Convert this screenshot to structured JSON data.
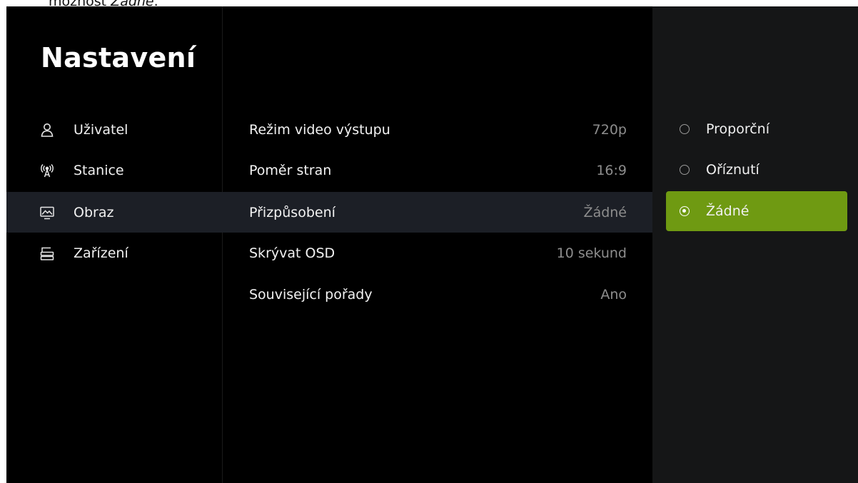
{
  "doc_note": {
    "prefix": "možnost ",
    "emphasis": "Žádné",
    "suffix": "."
  },
  "header": {
    "title": "Nastavení"
  },
  "nav": {
    "items": [
      {
        "label": "Uživatel",
        "icon": "user-icon"
      },
      {
        "label": "Stanice",
        "icon": "antenna-icon"
      },
      {
        "label": "Obraz",
        "icon": "picture-icon",
        "active": true
      },
      {
        "label": "Zařízení",
        "icon": "set-top-box-icon"
      }
    ]
  },
  "settings": {
    "rows": [
      {
        "name": "Režim video výstupu",
        "value": "720p"
      },
      {
        "name": "Poměr stran",
        "value": "16:9"
      },
      {
        "name": "Přizpůsobení",
        "value": "Žádné",
        "active": true
      },
      {
        "name": "Skrývat OSD",
        "value": "10 sekund"
      },
      {
        "name": "Související pořady",
        "value": "Ano"
      }
    ]
  },
  "options": {
    "items": [
      {
        "label": "Proporční",
        "selected": false
      },
      {
        "label": "Oříznutí",
        "selected": false
      },
      {
        "label": "Žádné",
        "selected": true
      }
    ]
  },
  "colors": {
    "screen_background": "#000000",
    "highlight_row": "#1c1f26",
    "options_panel": "#151617",
    "accent_selected": "#6f9a12",
    "value_text": "#8d8d8d"
  }
}
